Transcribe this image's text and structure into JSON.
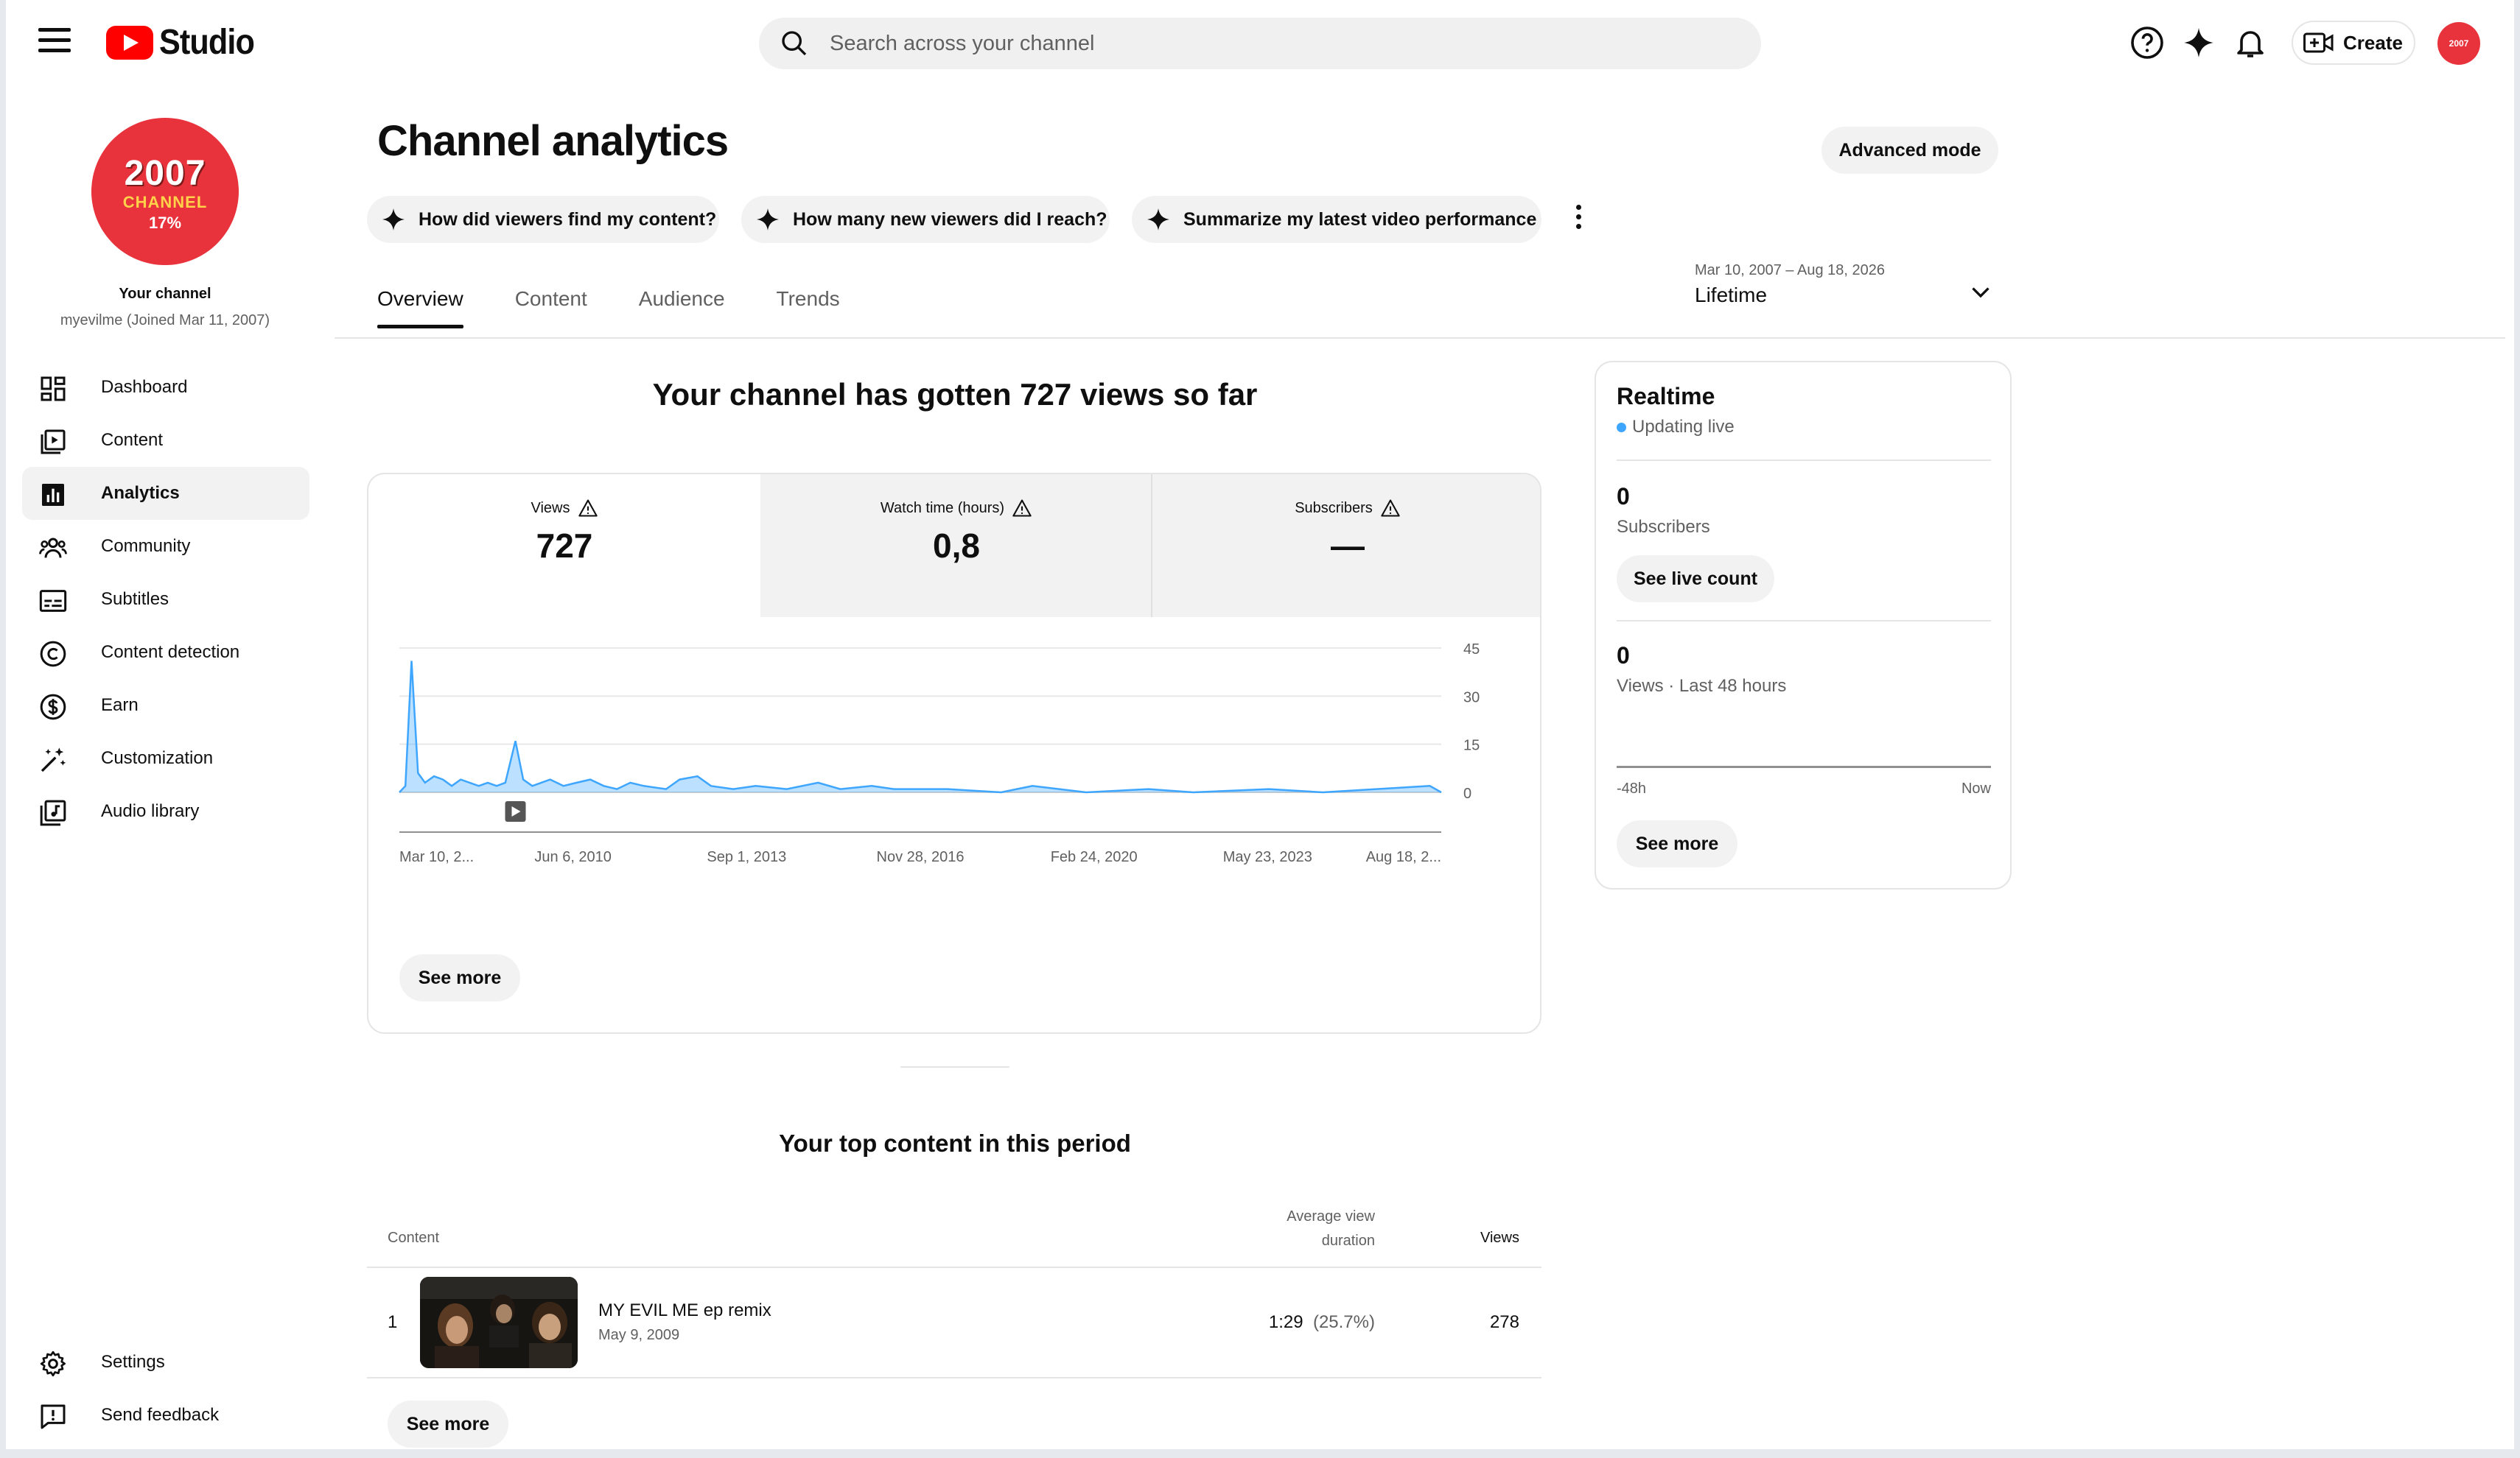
{
  "header": {
    "logo_text": "Studio",
    "search_placeholder": "Search across your channel",
    "create_label": "Create",
    "avatar_text": "2007"
  },
  "sidebar": {
    "avatar": {
      "year": "2007",
      "channel": "CHANNEL",
      "percent": "17%"
    },
    "your_channel": "Your channel",
    "joined": "myevilme (Joined Mar 11, 2007)",
    "items": [
      {
        "label": "Dashboard",
        "icon": "dashboard-icon"
      },
      {
        "label": "Content",
        "icon": "content-icon"
      },
      {
        "label": "Analytics",
        "icon": "analytics-icon"
      },
      {
        "label": "Community",
        "icon": "community-icon"
      },
      {
        "label": "Subtitles",
        "icon": "subtitles-icon"
      },
      {
        "label": "Content detection",
        "icon": "copyright-icon"
      },
      {
        "label": "Earn",
        "icon": "dollar-icon"
      },
      {
        "label": "Customization",
        "icon": "magic-wand-icon"
      },
      {
        "label": "Audio library",
        "icon": "audio-library-icon"
      }
    ],
    "bottom_items": [
      {
        "label": "Settings",
        "icon": "gear-icon"
      },
      {
        "label": "Send feedback",
        "icon": "feedback-icon"
      }
    ]
  },
  "main": {
    "title": "Channel analytics",
    "advanced_mode": "Advanced mode",
    "chips": [
      "How did viewers find my content?",
      "How many new viewers did I reach?",
      "Summarize my latest video performance"
    ],
    "tabs": [
      "Overview",
      "Content",
      "Audience",
      "Trends"
    ],
    "date_range": {
      "range": "Mar 10, 2007 – Aug 18, 2026",
      "label": "Lifetime"
    },
    "headline": "Your channel has gotten 727 views so far",
    "metrics": [
      {
        "label": "Views",
        "value": "727"
      },
      {
        "label": "Watch time (hours)",
        "value": "0,8"
      },
      {
        "label": "Subscribers",
        "value": "—"
      }
    ],
    "see_more": "See more",
    "top_content": {
      "title": "Your top content in this period",
      "col_content": "Content",
      "col_avd_line1": "Average view",
      "col_avd_line2": "duration",
      "col_views": "Views",
      "rows": [
        {
          "rank": "1",
          "name": "MY EVIL ME ep remix",
          "date": "May 9, 2009",
          "avd": "1:29",
          "avd_pct": "(25.7%)",
          "views": "278"
        }
      ],
      "see_more": "See more"
    }
  },
  "realtime": {
    "title": "Realtime",
    "live": "Updating live",
    "subscribers_value": "0",
    "subscribers_label": "Subscribers",
    "see_live_count": "See live count",
    "views_value": "0",
    "views_label": "Views · Last 48 hours",
    "axis_start": "-48h",
    "axis_end": "Now",
    "see_more": "See more"
  },
  "chart_data": {
    "type": "area",
    "title": "",
    "xlabel": "",
    "ylabel": "",
    "x_tick_labels": [
      "Mar 10, 2...",
      "Jun 6, 2010",
      "Sep 1, 2013",
      "Nov 28, 2016",
      "Feb 24, 2020",
      "May 23, 2023",
      "Aug 18, 2..."
    ],
    "y_ticks": [
      0,
      15,
      30,
      45
    ],
    "ylim": [
      0,
      45
    ],
    "x_range": [
      "2007-03-10",
      "2026-08-18"
    ],
    "grid": true,
    "color": "#3ea6ff",
    "series": [
      {
        "values": [
          {
            "x": "2007-03-10",
            "y": 0
          },
          {
            "x": "2007-04-20",
            "y": 2
          },
          {
            "x": "2007-06-01",
            "y": 41
          },
          {
            "x": "2007-07-15",
            "y": 6
          },
          {
            "x": "2007-09-01",
            "y": 3
          },
          {
            "x": "2007-11-01",
            "y": 5
          },
          {
            "x": "2008-01-01",
            "y": 4
          },
          {
            "x": "2008-03-01",
            "y": 2
          },
          {
            "x": "2008-05-01",
            "y": 4
          },
          {
            "x": "2008-07-01",
            "y": 3
          },
          {
            "x": "2008-09-01",
            "y": 2
          },
          {
            "x": "2008-11-01",
            "y": 3
          },
          {
            "x": "2009-01-01",
            "y": 2
          },
          {
            "x": "2009-03-01",
            "y": 3
          },
          {
            "x": "2009-05-09",
            "y": 16
          },
          {
            "x": "2009-07-01",
            "y": 4
          },
          {
            "x": "2009-09-01",
            "y": 2
          },
          {
            "x": "2009-11-01",
            "y": 3
          },
          {
            "x": "2010-01-01",
            "y": 4
          },
          {
            "x": "2010-04-01",
            "y": 2
          },
          {
            "x": "2010-07-01",
            "y": 3
          },
          {
            "x": "2010-10-01",
            "y": 4
          },
          {
            "x": "2011-01-01",
            "y": 2
          },
          {
            "x": "2011-04-01",
            "y": 1
          },
          {
            "x": "2011-07-01",
            "y": 3
          },
          {
            "x": "2011-10-01",
            "y": 2
          },
          {
            "x": "2012-03-01",
            "y": 1
          },
          {
            "x": "2012-06-01",
            "y": 4
          },
          {
            "x": "2012-10-01",
            "y": 5
          },
          {
            "x": "2013-01-01",
            "y": 2
          },
          {
            "x": "2013-06-01",
            "y": 1
          },
          {
            "x": "2013-11-01",
            "y": 2
          },
          {
            "x": "2014-06-01",
            "y": 1
          },
          {
            "x": "2015-01-01",
            "y": 3
          },
          {
            "x": "2015-06-01",
            "y": 1
          },
          {
            "x": "2016-01-01",
            "y": 2
          },
          {
            "x": "2016-06-01",
            "y": 1
          },
          {
            "x": "2017-06-01",
            "y": 1
          },
          {
            "x": "2018-06-01",
            "y": 0
          },
          {
            "x": "2019-01-01",
            "y": 2
          },
          {
            "x": "2020-01-01",
            "y": 0
          },
          {
            "x": "2021-03-01",
            "y": 1
          },
          {
            "x": "2022-01-01",
            "y": 0
          },
          {
            "x": "2023-06-01",
            "y": 1
          },
          {
            "x": "2024-06-01",
            "y": 0
          },
          {
            "x": "2025-06-01",
            "y": 1
          },
          {
            "x": "2026-06-01",
            "y": 2
          },
          {
            "x": "2026-08-18",
            "y": 0
          }
        ]
      }
    ]
  }
}
